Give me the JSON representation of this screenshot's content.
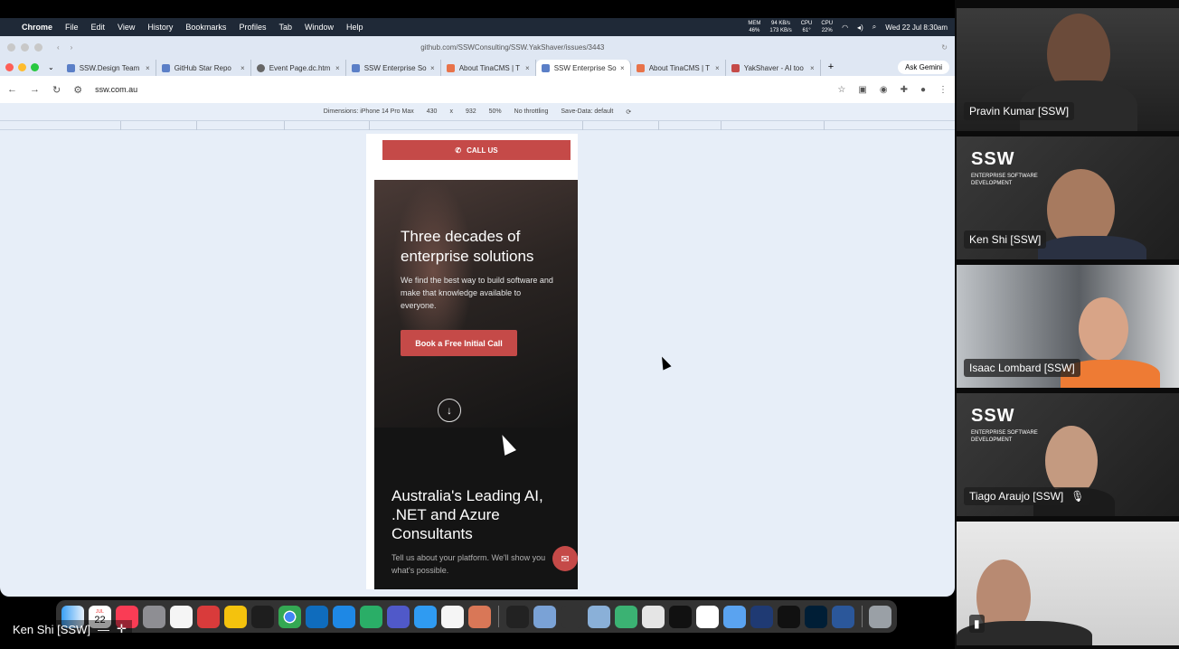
{
  "menubar": {
    "app": "Chrome",
    "items": [
      "File",
      "Edit",
      "View",
      "History",
      "Bookmarks",
      "Profiles",
      "Tab",
      "Window",
      "Help"
    ],
    "mem_label": "MEM",
    "mem_value": "46%",
    "net_up": "94 KB/s",
    "net_down": "173 KB/s",
    "cpu_temp_label": "CPU",
    "cpu_temp": "61°",
    "cpu_label": "CPU",
    "cpu_value": "22%",
    "clock": "Wed 22 Jul  8:30am"
  },
  "browser": {
    "back_url": "github.com/SSWConsulting/SSW.YakShaver/issues/3443",
    "tabs": [
      {
        "label": "SSW.Design Team",
        "active": false
      },
      {
        "label": "GitHub Star Repo",
        "active": false
      },
      {
        "label": "Event Page.dc.htm",
        "active": false
      },
      {
        "label": "SSW Enterprise So",
        "active": false
      },
      {
        "label": "About TinaCMS | T",
        "active": false
      },
      {
        "label": "SSW Enterprise So",
        "active": true
      },
      {
        "label": "About TinaCMS | T",
        "active": false
      },
      {
        "label": "YakShaver - AI too",
        "active": false
      }
    ],
    "new_tab": "+",
    "gemini": "Ask Gemini",
    "address": "ssw.com.au"
  },
  "devtools": {
    "dimensions_label": "Dimensions: iPhone 14 Pro Max",
    "width": "430",
    "times": "x",
    "height": "932",
    "zoom": "50%",
    "throttle": "No throttling",
    "save_data": "Save-Data: default"
  },
  "site": {
    "call_us": "CALL US",
    "hero_title": "Three decades of enterprise solutions",
    "hero_text": "We find the best way to build software and make that knowledge available to everyone.",
    "cta": "Book a Free Initial Call",
    "section_title": "Australia's Leading AI, .NET and Azure Consultants",
    "section_text": "Tell us about your platform. We'll show you what's possible."
  },
  "presenter": {
    "name": "Ken Shi [SSW]"
  },
  "participants": [
    {
      "name": "Pravin Kumar [SSW]",
      "muted": false
    },
    {
      "name": "Ken Shi [SSW]",
      "muted": false
    },
    {
      "name": "Isaac Lombard [SSW]",
      "muted": false
    },
    {
      "name": "Tiago Araujo [SSW]",
      "muted": true
    },
    {
      "name": "",
      "muted": false
    }
  ],
  "ssw_logo": {
    "text": "SSW",
    "tagline": "ENTERPRISE SOFTWARE DEVELOPMENT"
  },
  "dock": {
    "calendar_day": "22",
    "calendar_month": "JUL"
  }
}
